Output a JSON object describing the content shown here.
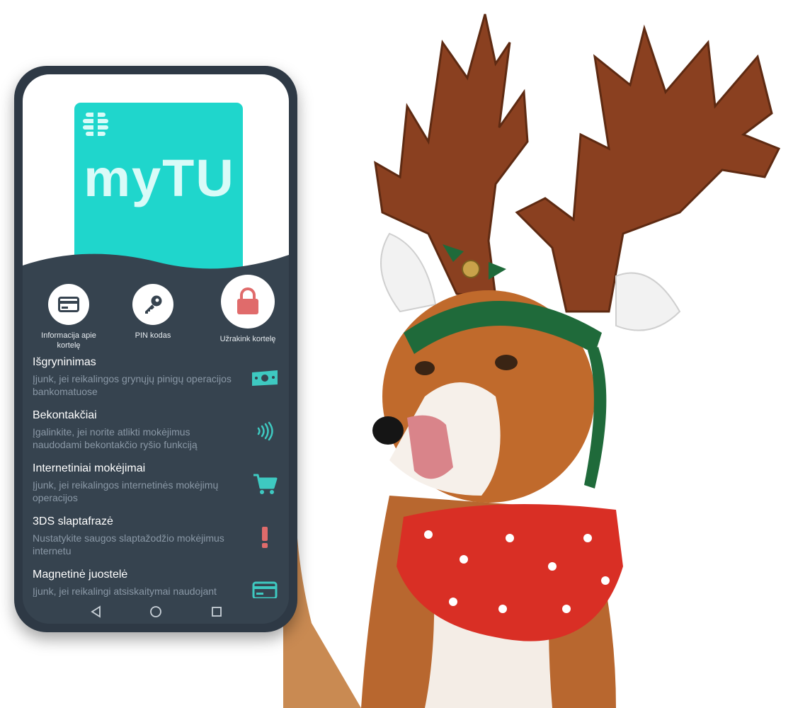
{
  "card": {
    "brand": "myTU",
    "color": "#1fd6cc"
  },
  "actions": [
    {
      "label": "Informacija apie kortelę",
      "icon": "card-icon"
    },
    {
      "label": "PIN kodas",
      "icon": "key-icon"
    },
    {
      "label": "Užrakink kortelę",
      "icon": "lock-icon",
      "accent": "#e06b6b"
    }
  ],
  "settings": [
    {
      "title": "Išgryninimas",
      "desc": "Įjunk, jei reikalingos grynųjų pinigų operacijos bankomatuose",
      "icon": "cash-icon"
    },
    {
      "title": "Bekontakčiai",
      "desc": "Įgalinkite, jei norite atlikti mokėjimus naudodami bekontakčio ryšio funkciją",
      "icon": "contactless-icon"
    },
    {
      "title": "Internetiniai mokėjimai",
      "desc": "Įjunk, jei reikalingos internetinės mokėjimų operacijos",
      "icon": "cart-icon"
    },
    {
      "title": "3DS slaptafrazė",
      "desc": "Nustatykite saugos slaptažodžio mokėjimus internetu",
      "icon": "exclamation-icon"
    },
    {
      "title": "Magnetinė juostelė",
      "desc": "Įjunk, jei reikalingi atsiskaitymai naudojant magnetinę juostelę",
      "icon": "card-stripe-icon"
    }
  ],
  "colors": {
    "teal": "#3ec9c1",
    "danger": "#e06b6b",
    "phone_bg": "#36434f"
  },
  "navbar": {
    "buttons": [
      "back-icon",
      "home-icon",
      "recents-icon"
    ]
  }
}
